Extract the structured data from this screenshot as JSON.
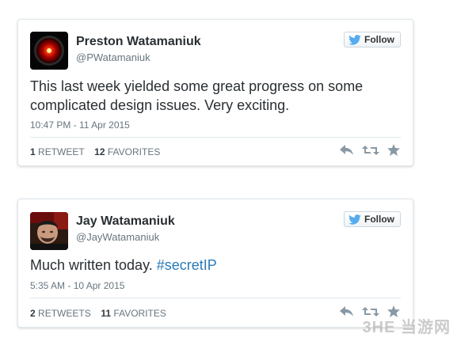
{
  "tweets": [
    {
      "name": "Preston Watamaniuk",
      "handle": "@PWatamaniuk",
      "follow_label": "Follow",
      "text": "This last week yielded some great progress on some complicated design issues.  Very exciting.",
      "timestamp": "10:47 PM - 11 Apr 2015",
      "retweets_count": "1",
      "retweets_label": "RETWEET",
      "favorites_count": "12",
      "favorites_label": "FAVORITES",
      "avatar_icon": "hal-9000-eye-icon"
    },
    {
      "name": "Jay Watamaniuk",
      "handle": "@JayWatamaniuk",
      "follow_label": "Follow",
      "text_plain": "Much written today. ",
      "text_hashtag": "#secretIP",
      "timestamp": "5:35 AM - 10 Apr 2015",
      "retweets_count": "2",
      "retweets_label": "RETWEETS",
      "favorites_count": "11",
      "favorites_label": "FAVORITES",
      "avatar_icon": "user-photo-avatar"
    }
  ],
  "watermark": "3HE 当游网",
  "colors": {
    "text": "#292f33",
    "muted": "#66757f",
    "hashtag": "#2b7bb9",
    "twitter_blue": "#55acee",
    "border": "#e1e8ed"
  }
}
